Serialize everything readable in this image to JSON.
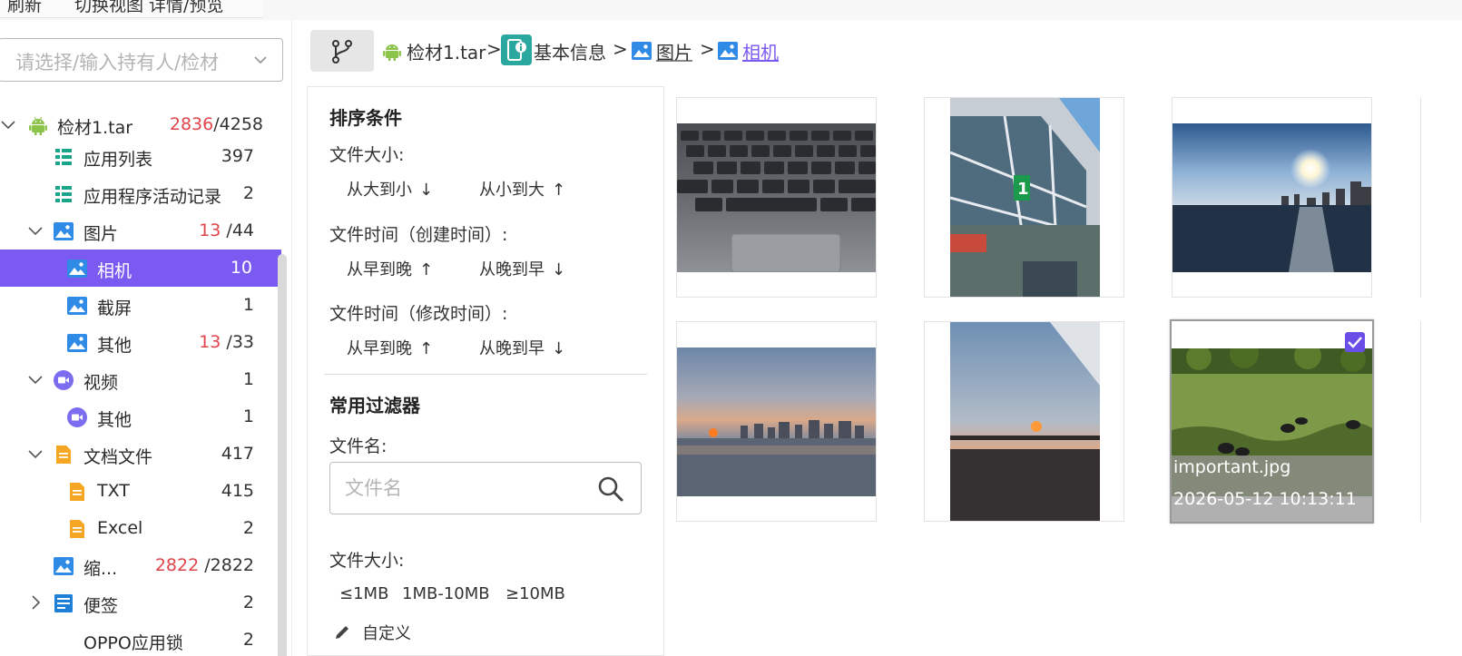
{
  "toolbar": {
    "refresh_label": "刷新",
    "switch_view_label": "切换视图 详情/预览"
  },
  "owner_select": {
    "placeholder": "请选择/输入持有人/检材"
  },
  "tree": {
    "evidence": {
      "label": "检材1.tar",
      "count_red": "2836",
      "count_total": "/4258"
    },
    "app_list": {
      "label": "应用列表",
      "count": "397"
    },
    "app_activity": {
      "label": "应用程序活动记录",
      "count": "2"
    },
    "pictures": {
      "label": "图片",
      "count_red": "13",
      "count_total": "/44"
    },
    "camera": {
      "label": "相机",
      "count": "10"
    },
    "screenshot": {
      "label": "截屏",
      "count": "1"
    },
    "pic_other": {
      "label": "其他",
      "count_red": "13",
      "count_total": "/33"
    },
    "video": {
      "label": "视频",
      "count": "1"
    },
    "video_other": {
      "label": "其他",
      "count": "1"
    },
    "documents": {
      "label": "文档文件",
      "count": "417"
    },
    "txt": {
      "label": "TXT",
      "count": "415"
    },
    "excel": {
      "label": "Excel",
      "count": "2"
    },
    "thumbnail": {
      "label": "缩...",
      "count_red": "2822",
      "count_total": "/2822"
    },
    "notes": {
      "label": "便签",
      "count": "2"
    },
    "oppo": {
      "label": "OPPO应用锁",
      "count": "2"
    }
  },
  "breadcrumb": {
    "evidence": "检材1.tar",
    "basic_info": "基本信息",
    "pictures": "图片",
    "camera": "相机",
    "separator": ">"
  },
  "filter": {
    "sort_title": "排序条件",
    "file_size_label": "文件大小:",
    "size_desc": "从大到小",
    "size_asc": "从小到大",
    "ctime_label": "文件时间（创建时间）:",
    "ctime_asc": "从早到晚",
    "ctime_desc": "从晚到早",
    "mtime_label": "文件时间（修改时间）:",
    "mtime_asc": "从早到晚",
    "mtime_desc": "从晚到早",
    "common_title": "常用过滤器",
    "filename_label": "文件名:",
    "filename_placeholder": "文件名",
    "filesize_label": "文件大小:",
    "size_opt1": "≤1MB",
    "size_opt2": "1MB-10MB",
    "size_opt3": "≥10MB",
    "custom_label": "自定义",
    "arrow_down": "↓",
    "arrow_up": "↑"
  },
  "gallery": {
    "selected_name": "important.jpg",
    "selected_date": "2026-05-12 10:13:11"
  },
  "colors": {
    "accent": "#7a5af0",
    "red_count": "#e0454b",
    "android_green": "#8cc34a",
    "image_icon_blue": "#2f8be6",
    "video_icon_purple": "#7b6cf0",
    "doc_icon_orange": "#f5a623",
    "info_teal": "#2aa8a0"
  },
  "icons": [
    "android-icon",
    "list-icon",
    "image-icon",
    "video-icon",
    "document-icon",
    "note-icon",
    "branch-icon",
    "search-icon",
    "pencil-icon",
    "chevron-down-icon",
    "check-icon"
  ]
}
